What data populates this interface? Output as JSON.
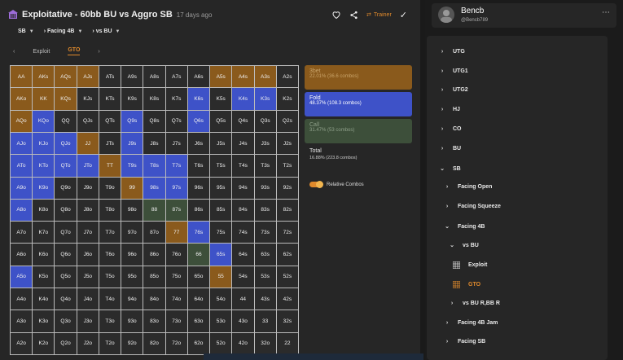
{
  "header": {
    "title": "Exploitative - 60bb BU vs Aggro SB",
    "age": "17 days ago",
    "trainer_label": "Trainer"
  },
  "filters": [
    {
      "label": "SB"
    },
    {
      "label": "Facing 4B",
      "chev": true
    },
    {
      "label": "vs BU",
      "chev": true
    }
  ],
  "tabs": {
    "exploit": "Exploit",
    "gto": "GTO"
  },
  "hands": [
    [
      "AA",
      "AKs",
      "AQs",
      "AJs",
      "ATs",
      "A9s",
      "A8s",
      "A7s",
      "A6s",
      "A5s",
      "A4s",
      "A3s",
      "A2s"
    ],
    [
      "AKo",
      "KK",
      "KQs",
      "KJs",
      "KTs",
      "K9s",
      "K8s",
      "K7s",
      "K6s",
      "K5s",
      "K4s",
      "K3s",
      "K2s"
    ],
    [
      "AQo",
      "KQo",
      "QQ",
      "QJs",
      "QTs",
      "Q9s",
      "Q8s",
      "Q7s",
      "Q6s",
      "Q5s",
      "Q4s",
      "Q3s",
      "Q2s"
    ],
    [
      "AJo",
      "KJo",
      "QJo",
      "JJ",
      "JTs",
      "J9s",
      "J8s",
      "J7s",
      "J6s",
      "J5s",
      "J4s",
      "J3s",
      "J2s"
    ],
    [
      "ATo",
      "KTo",
      "QTo",
      "JTo",
      "TT",
      "T9s",
      "T8s",
      "T7s",
      "T6s",
      "T5s",
      "T4s",
      "T3s",
      "T2s"
    ],
    [
      "A9o",
      "K9o",
      "Q9o",
      "J9o",
      "T9o",
      "99",
      "98s",
      "97s",
      "96s",
      "95s",
      "94s",
      "93s",
      "92s"
    ],
    [
      "A8o",
      "K8o",
      "Q8o",
      "J8o",
      "T8o",
      "98o",
      "88",
      "87s",
      "86s",
      "85s",
      "84s",
      "83s",
      "82s"
    ],
    [
      "A7o",
      "K7o",
      "Q7o",
      "J7o",
      "T7o",
      "97o",
      "87o",
      "77",
      "76s",
      "75s",
      "74s",
      "73s",
      "72s"
    ],
    [
      "A6o",
      "K6o",
      "Q6o",
      "J6o",
      "T6o",
      "96o",
      "86o",
      "76o",
      "66",
      "65s",
      "64s",
      "63s",
      "62s"
    ],
    [
      "A5o",
      "K5o",
      "Q5o",
      "J5o",
      "T5o",
      "95o",
      "85o",
      "75o",
      "65o",
      "55",
      "54s",
      "53s",
      "52s"
    ],
    [
      "A4o",
      "K4o",
      "Q4o",
      "J4o",
      "T4o",
      "94o",
      "84o",
      "74o",
      "64o",
      "54o",
      "44",
      "43s",
      "42s"
    ],
    [
      "A3o",
      "K3o",
      "Q3o",
      "J3o",
      "T3o",
      "93o",
      "83o",
      "73o",
      "63o",
      "53o",
      "43o",
      "33",
      "32s"
    ],
    [
      "A2o",
      "K2o",
      "Q2o",
      "J2o",
      "T2o",
      "92o",
      "82o",
      "72o",
      "62o",
      "52o",
      "42o",
      "32o",
      "22"
    ]
  ],
  "hand_colors": {
    "AA": "#8a5a1c",
    "AKs": "#8a5a1c",
    "AQs": "#8a5a1c",
    "AJs": "#8a5a1c",
    "A5s": "#8a5a1c",
    "A4s": "#8a5a1c",
    "A3s": "#8a5a1c",
    "AKo": "#8a5a1c",
    "KK": "#8a5a1c",
    "KQs": "#8a5a1c",
    "K6s": "#3e52c8",
    "K4s": "#3e52c8",
    "K3s": "#3e52c8",
    "AQo": "#8a5a1c",
    "KQo": "#3e52c8",
    "Q9s": "#3e52c8",
    "Q6s": "#3e52c8",
    "AJo": "#3e52c8",
    "KJo": "#3e52c8",
    "QJo": "#3e52c8",
    "JJ": "#8a5a1c",
    "J9s": "#3e52c8",
    "ATo": "#3e52c8",
    "KTo": "#3e52c8",
    "QTo": "#3e52c8",
    "JTo": "#3e52c8",
    "TT": "#8a5a1c",
    "T9s": "#3e52c8",
    "T8s": "#3e52c8",
    "T7s": "#3e52c8",
    "A9o": "#3e52c8",
    "K9o": "#3e52c8",
    "99": "#8a5a1c",
    "98s": "#3e52c8",
    "97s": "#3e52c8",
    "A8o": "#3e52c8",
    "87s": "#3d4f3a",
    "88": "#3d4f3a",
    "77": "#8a5a1c",
    "76s": "#3e52c8",
    "66": "#3d4f3a",
    "65s": "#3e52c8",
    "A5o": "#3e52c8",
    "55": "#8a5a1c"
  },
  "strategy": [
    {
      "label": "3bet",
      "detail": "22.01% (36.6 combos)"
    },
    {
      "label": "Fold",
      "detail": "48.37% (108.3 combos)"
    },
    {
      "label": "Call",
      "detail": "31.47% (53 combos)"
    }
  ],
  "total": {
    "label": "Total",
    "detail": "16.88% (223.8 combos)"
  },
  "relative_combos": "Relative Combos",
  "user": {
    "name": "Bencb",
    "handle": "@Bencb789"
  },
  "tree": {
    "utg": "UTG",
    "utg1": "UTG1",
    "utg2": "UTG2",
    "hj": "HJ",
    "co": "CO",
    "bu": "BU",
    "sb": "SB",
    "facing_open": "Facing Open",
    "facing_squeeze": "Facing Squeeze",
    "facing_4b": "Facing 4B",
    "vs_bu": "vs BU",
    "exploit": "Exploit",
    "gto": "GTO",
    "vs_bu_rbbr": "vs BU R,BB R",
    "facing_4b_jam": "Facing 4B Jam",
    "facing_sb": "Facing SB"
  },
  "colors": {
    "accent": "#e08a2c",
    "fold": "#3e52c8",
    "raise": "#8a5a1c",
    "call": "#3d4f3a"
  }
}
